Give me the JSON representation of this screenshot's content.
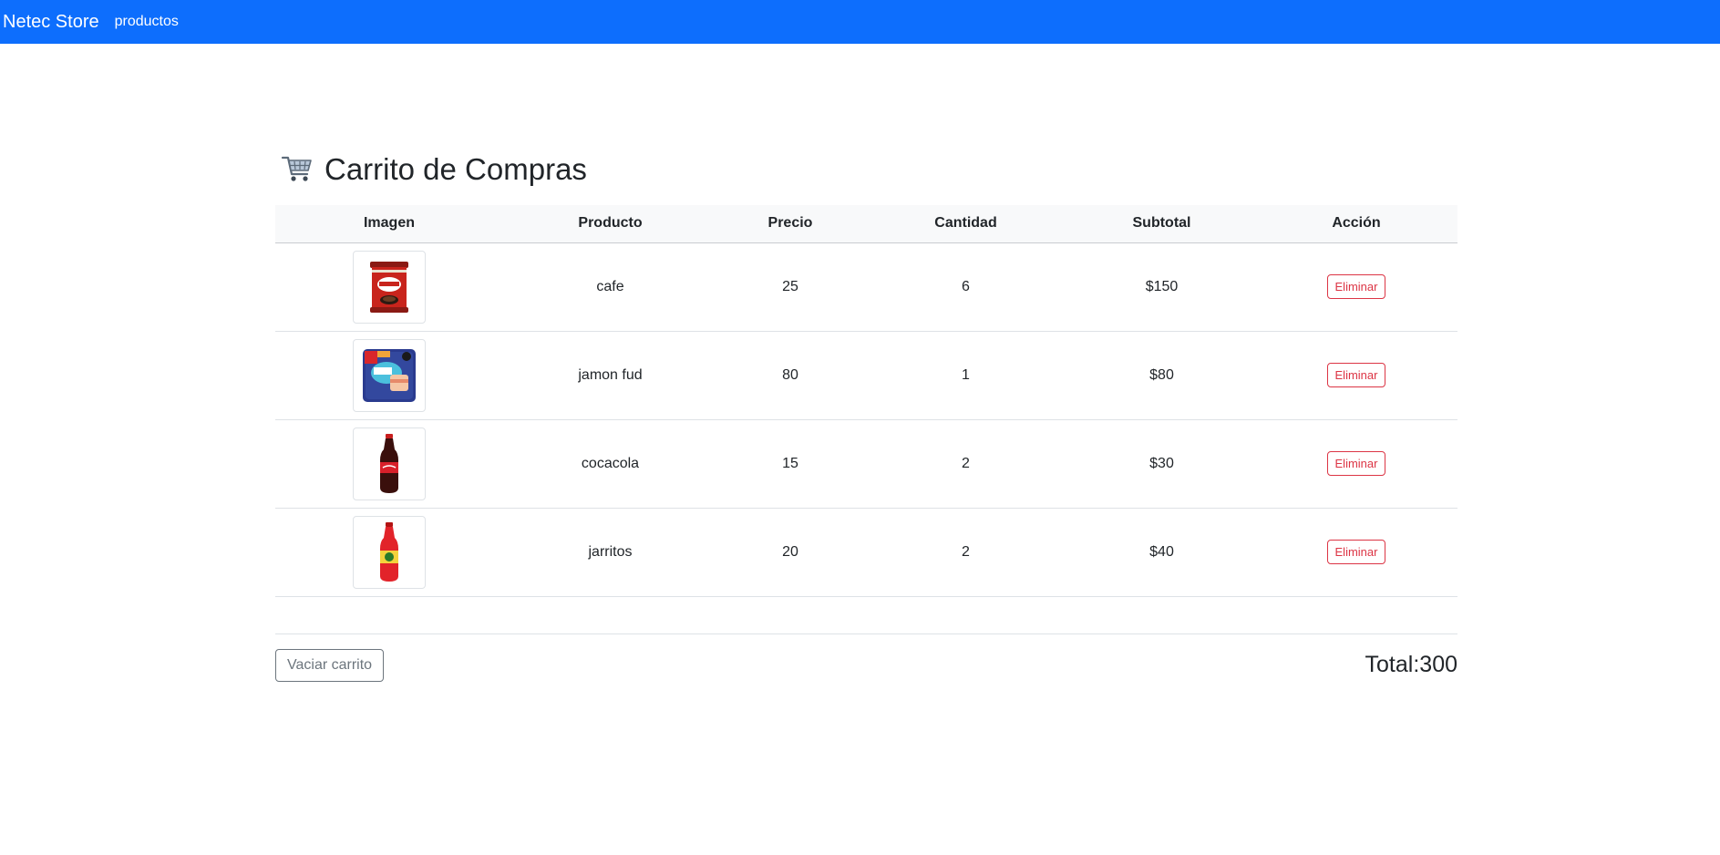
{
  "navbar": {
    "brand": "Netec Store",
    "link": "productos",
    "color": "#0d6efd"
  },
  "page": {
    "icon": "shopping-cart-icon",
    "title": "Carrito de Compras"
  },
  "table": {
    "headers": [
      "Imagen",
      "Producto",
      "Precio",
      "Cantidad",
      "Subtotal",
      "Acción"
    ],
    "rows": [
      {
        "image": "coffee-can-image",
        "product": "cafe",
        "price": "25",
        "qty": "6",
        "subtotal": "$150",
        "action": "Eliminar"
      },
      {
        "image": "ham-package-image",
        "product": "jamon fud",
        "price": "80",
        "qty": "1",
        "subtotal": "$80",
        "action": "Eliminar"
      },
      {
        "image": "cola-bottle-image",
        "product": "cocacola",
        "price": "15",
        "qty": "2",
        "subtotal": "$30",
        "action": "Eliminar"
      },
      {
        "image": "soda-bottle-image",
        "product": "jarritos",
        "price": "20",
        "qty": "2",
        "subtotal": "$40",
        "action": "Eliminar"
      }
    ]
  },
  "footer": {
    "clear_label": "Vaciar carrito",
    "total": "Total:300"
  },
  "colors": {
    "danger": "#dc3545",
    "secondary": "#6c757d"
  }
}
